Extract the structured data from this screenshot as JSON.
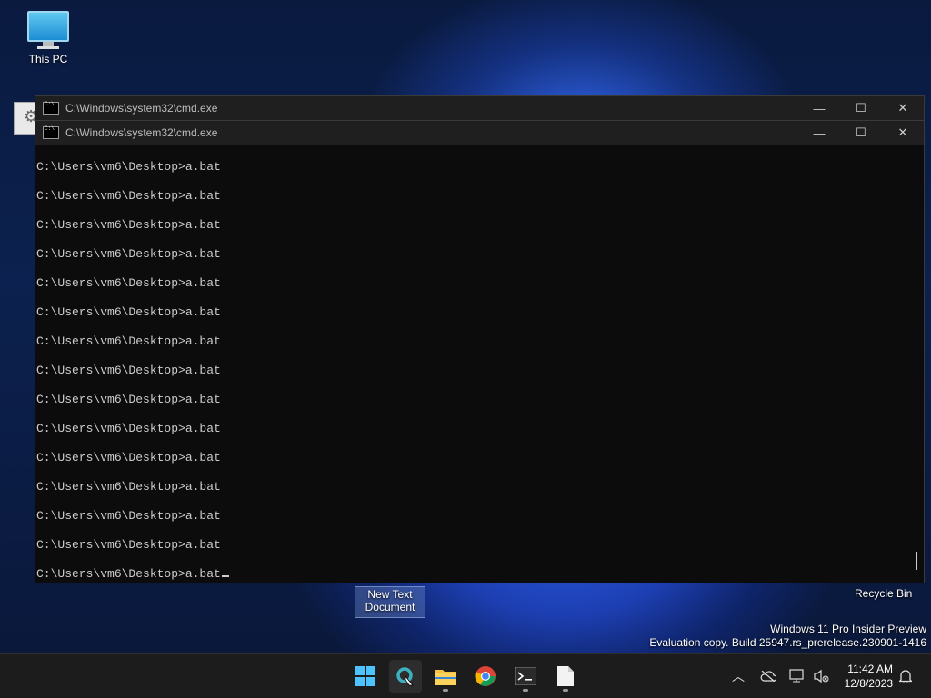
{
  "desktop": {
    "icons": [
      {
        "label": "This PC"
      },
      {
        "label": "New Text\nDocument"
      },
      {
        "label": "Recycle Bin"
      }
    ]
  },
  "windows": [
    {
      "title": "C:\\Windows\\system32\\cmd.exe"
    },
    {
      "title": "C:\\Windows\\system32\\cmd.exe"
    }
  ],
  "window_controls": {
    "minimize": "—",
    "maximize": "☐",
    "close": "✕"
  },
  "console": {
    "lines": [
      "C:\\Users\\vm6\\Desktop>a.bat",
      "C:\\Users\\vm6\\Desktop>a.bat",
      "C:\\Users\\vm6\\Desktop>a.bat",
      "C:\\Users\\vm6\\Desktop>a.bat",
      "C:\\Users\\vm6\\Desktop>a.bat",
      "C:\\Users\\vm6\\Desktop>a.bat",
      "C:\\Users\\vm6\\Desktop>a.bat",
      "C:\\Users\\vm6\\Desktop>a.bat",
      "C:\\Users\\vm6\\Desktop>a.bat",
      "C:\\Users\\vm6\\Desktop>a.bat",
      "C:\\Users\\vm6\\Desktop>a.bat",
      "C:\\Users\\vm6\\Desktop>a.bat",
      "C:\\Users\\vm6\\Desktop>a.bat",
      "C:\\Users\\vm6\\Desktop>a.bat",
      "C:\\Users\\vm6\\Desktop>a.bat"
    ]
  },
  "watermark": {
    "line1": "Windows 11 Pro Insider Preview",
    "line2": "Evaluation copy. Build 25947.rs_prerelease.230901-1416"
  },
  "taskbar": {
    "apps": [
      {
        "icon": "windows-start-icon"
      },
      {
        "icon": "search-icon"
      },
      {
        "icon": "file-explorer-icon"
      },
      {
        "icon": "chrome-icon"
      },
      {
        "icon": "terminal-icon"
      },
      {
        "icon": "file-icon"
      }
    ],
    "time": "11:42 AM",
    "date": "12/8/2023"
  }
}
